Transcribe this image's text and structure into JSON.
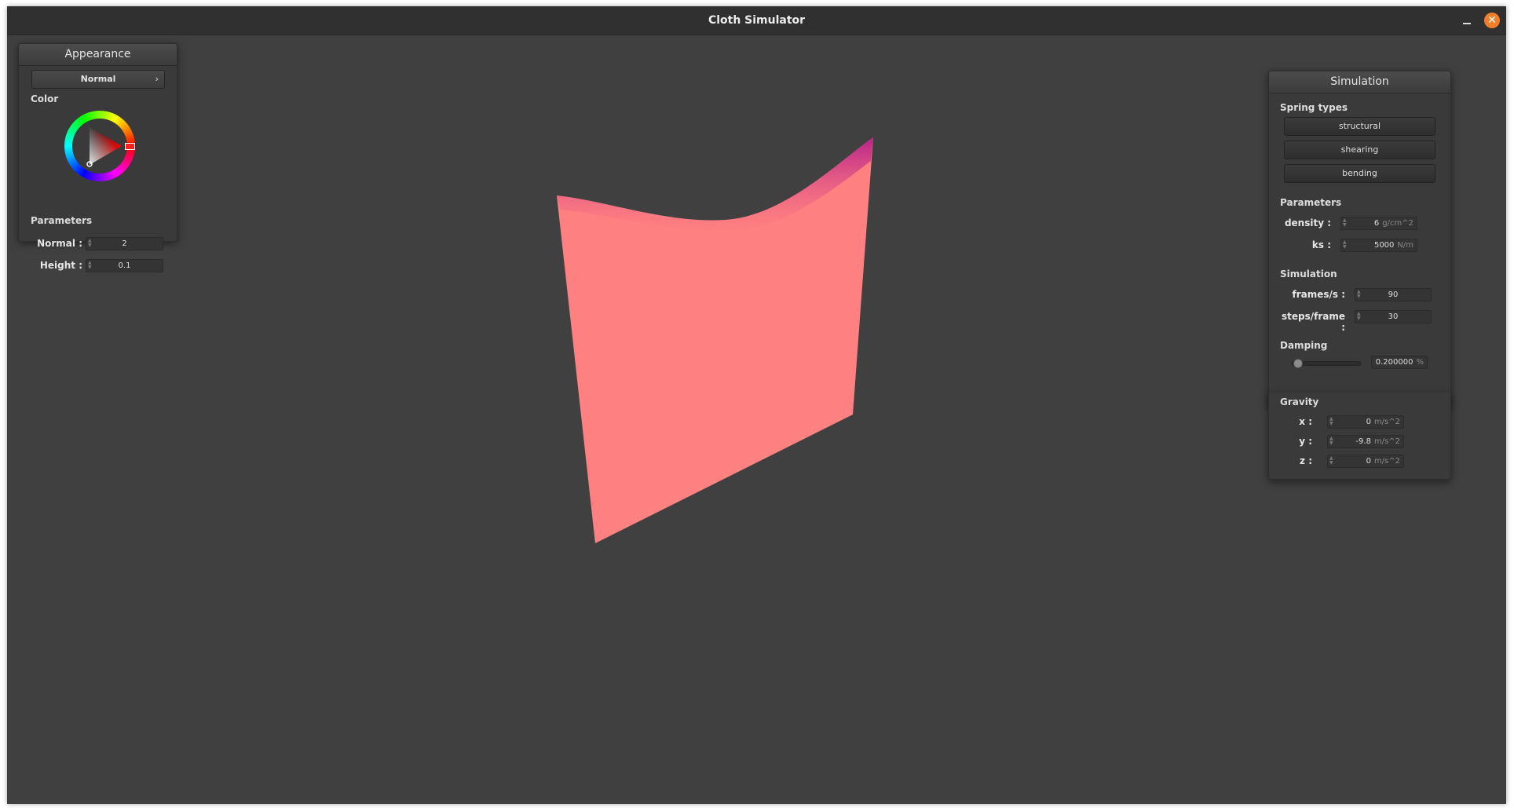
{
  "window": {
    "title": "Cloth Simulator"
  },
  "appearance": {
    "title": "Appearance",
    "shader_selected": "Normal",
    "color_label": "Color",
    "selected_color": "#ff7f7f",
    "parameters_label": "Parameters",
    "normal_label": "Normal :",
    "normal_value": "2",
    "height_label": "Height :",
    "height_value": "0.1"
  },
  "simulation": {
    "title": "Simulation",
    "spring_types_label": "Spring types",
    "springs": [
      "structural",
      "shearing",
      "bending"
    ],
    "parameters_label": "Parameters",
    "density_label": "density :",
    "density_value": "6",
    "density_unit": "g/cm^2",
    "ks_label": "ks :",
    "ks_value": "5000",
    "ks_unit": "N/m",
    "sim_section_label": "Simulation",
    "fps_label": "frames/s :",
    "fps_value": "90",
    "steps_label": "steps/frame :",
    "steps_value": "30",
    "damping_label": "Damping",
    "damping_value": "0.200000",
    "damping_unit": "%",
    "damping_level": 0.2,
    "gravity_label": "Gravity",
    "gx_label": "x :",
    "gx_value": "0",
    "gy_label": "y :",
    "gy_value": "-9.8",
    "gz_label": "z :",
    "gz_value": "0",
    "gravity_unit": "m/s^2"
  }
}
